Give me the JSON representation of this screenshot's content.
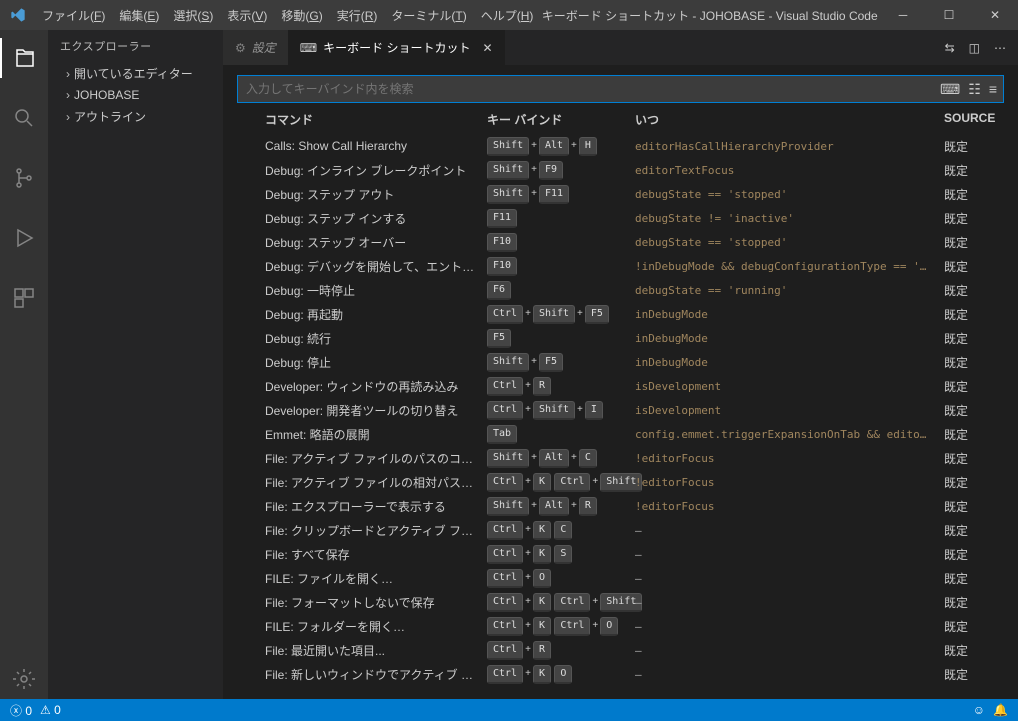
{
  "titlebar": {
    "menus": [
      "ファイル(F)",
      "編集(E)",
      "選択(S)",
      "表示(V)",
      "移動(G)",
      "実行(R)",
      "ターミナル(T)",
      "ヘルプ(H)"
    ],
    "title": "キーボード ショートカット - JOHOBASE - Visual Studio Code"
  },
  "sidebar": {
    "title": "エクスプローラー",
    "items": [
      "開いているエディター",
      "JOHOBASE",
      "アウトライン"
    ]
  },
  "tabs": {
    "inactive": "設定",
    "active": "キーボード ショートカット"
  },
  "search": {
    "placeholder": "入力してキーバインド内を検索"
  },
  "headers": {
    "command": "コマンド",
    "keybinding": "キー バインド",
    "when": "いつ",
    "source": "SOURCE"
  },
  "source_default": "既定",
  "rows": [
    {
      "cmd": "Calls: Show Call Hierarchy",
      "keys": [
        [
          "Shift",
          "Alt",
          "H"
        ]
      ],
      "when": "editorHasCallHierarchyProvider"
    },
    {
      "cmd": "Debug: インライン ブレークポイント",
      "keys": [
        [
          "Shift",
          "F9"
        ]
      ],
      "when": "editorTextFocus"
    },
    {
      "cmd": "Debug: ステップ アウト",
      "keys": [
        [
          "Shift",
          "F11"
        ]
      ],
      "when": "debugState == 'stopped'"
    },
    {
      "cmd": "Debug: ステップ インする",
      "keys": [
        [
          "F11"
        ]
      ],
      "when": "debugState != 'inactive'"
    },
    {
      "cmd": "Debug: ステップ オーバー",
      "keys": [
        [
          "F10"
        ]
      ],
      "when": "debugState == 'stopped'"
    },
    {
      "cmd": "Debug: デバッグを開始して、エントリで...",
      "keys": [
        [
          "F10"
        ]
      ],
      "when": "!inDebugMode && debugConfigurationType == '…"
    },
    {
      "cmd": "Debug: 一時停止",
      "keys": [
        [
          "F6"
        ]
      ],
      "when": "debugState == 'running'"
    },
    {
      "cmd": "Debug: 再起動",
      "keys": [
        [
          "Ctrl",
          "Shift",
          "F5"
        ]
      ],
      "when": "inDebugMode"
    },
    {
      "cmd": "Debug: 続行",
      "keys": [
        [
          "F5"
        ]
      ],
      "when": "inDebugMode"
    },
    {
      "cmd": "Debug: 停止",
      "keys": [
        [
          "Shift",
          "F5"
        ]
      ],
      "when": "inDebugMode"
    },
    {
      "cmd": "Developer: ウィンドウの再読み込み",
      "keys": [
        [
          "Ctrl",
          "R"
        ]
      ],
      "when": "isDevelopment"
    },
    {
      "cmd": "Developer: 開発者ツールの切り替え",
      "keys": [
        [
          "Ctrl",
          "Shift",
          "I"
        ]
      ],
      "when": "isDevelopment"
    },
    {
      "cmd": "Emmet: 略語の展開",
      "keys": [
        [
          "Tab"
        ]
      ],
      "when": "config.emmet.triggerExpansionOnTab && edito…"
    },
    {
      "cmd": "File: アクティブ ファイルのパスのコピー",
      "keys": [
        [
          "Shift",
          "Alt",
          "C"
        ]
      ],
      "when": "!editorFocus"
    },
    {
      "cmd": "File: アクティブ ファイルの相対パスをコピー",
      "keys": [
        [
          "Ctrl",
          "K"
        ],
        [
          "Ctrl",
          "Shift"
        ]
      ],
      "when": "!editorFocus"
    },
    {
      "cmd": "File: エクスプローラーで表示する",
      "keys": [
        [
          "Shift",
          "Alt",
          "R"
        ]
      ],
      "when": "!editorFocus"
    },
    {
      "cmd": "File: クリップボードとアクティブ ファイルを...",
      "keys": [
        [
          "Ctrl",
          "K"
        ],
        [
          "C"
        ]
      ],
      "when": "—"
    },
    {
      "cmd": "File: すべて保存",
      "keys": [
        [
          "Ctrl",
          "K"
        ],
        [
          "S"
        ]
      ],
      "when": "—"
    },
    {
      "cmd": "FILE: ファイルを開く…",
      "keys": [
        [
          "Ctrl",
          "O"
        ]
      ],
      "when": "—"
    },
    {
      "cmd": "File: フォーマットしないで保存",
      "keys": [
        [
          "Ctrl",
          "K"
        ],
        [
          "Ctrl",
          "Shift"
        ]
      ],
      "when": "—"
    },
    {
      "cmd": "FILE: フォルダーを開く…",
      "keys": [
        [
          "Ctrl",
          "K"
        ],
        [
          "Ctrl",
          "O"
        ]
      ],
      "when": "—"
    },
    {
      "cmd": "File: 最近開いた項目...",
      "keys": [
        [
          "Ctrl",
          "R"
        ]
      ],
      "when": "—"
    },
    {
      "cmd": "File: 新しいウィンドウでアクティブ ファイル...",
      "keys": [
        [
          "Ctrl",
          "K"
        ],
        [
          "O"
        ]
      ],
      "when": "—"
    }
  ],
  "status": {
    "errors": "0",
    "warnings": "0"
  }
}
